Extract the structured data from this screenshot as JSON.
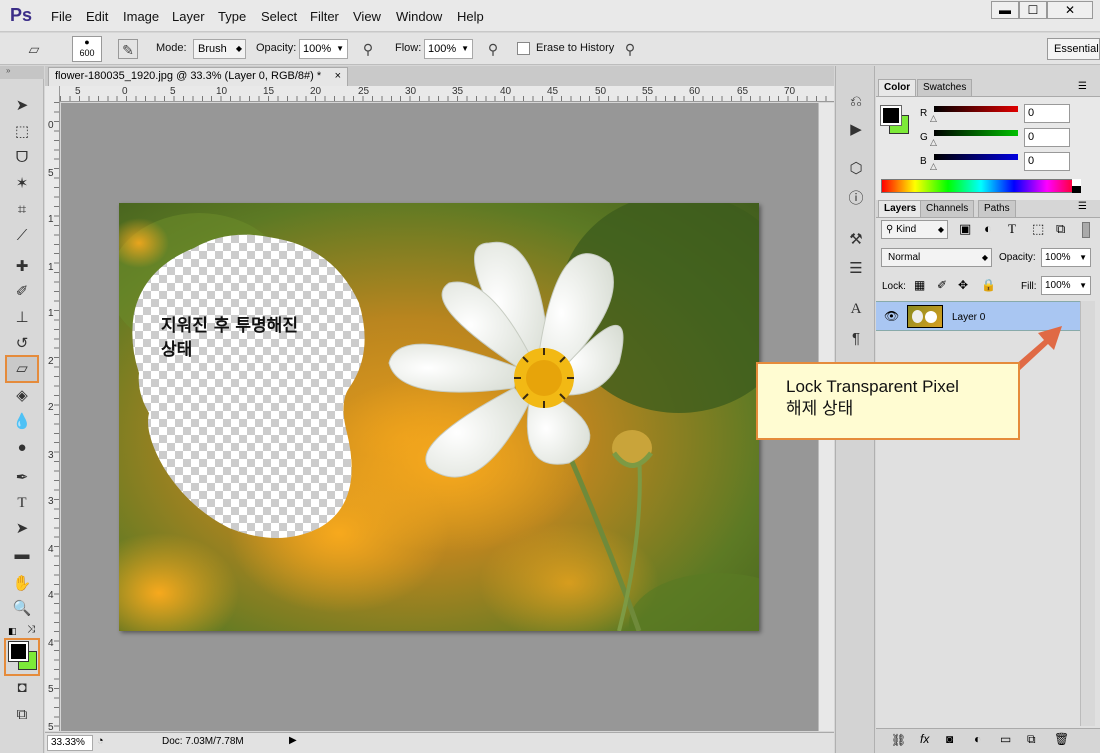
{
  "app": {
    "logo": "Ps"
  },
  "menu": [
    "File",
    "Edit",
    "Image",
    "Layer",
    "Type",
    "Select",
    "Filter",
    "View",
    "Window",
    "Help"
  ],
  "window_controls": {
    "minimize": "▬",
    "maximize": "☐",
    "close": "✕"
  },
  "options": {
    "brush_size": "600",
    "mode_label": "Mode:",
    "mode_value": "Brush",
    "opacity_label": "Opacity:",
    "opacity_value": "100%",
    "flow_label": "Flow:",
    "flow_value": "100%",
    "erase_history_label": "Erase to History",
    "workspace": "Essential"
  },
  "document": {
    "tab_title": "flower-180035_1920.jpg @ 33.3% (Layer 0, RGB/8#) *",
    "tab_close": "×",
    "ruler_h": [
      "5",
      "0",
      "5",
      "10",
      "15",
      "20",
      "25",
      "30",
      "35",
      "40",
      "45",
      "50",
      "55",
      "60",
      "65",
      "70"
    ],
    "ruler_v": [
      "0",
      "5",
      "1",
      "1",
      "1",
      "2",
      "2",
      "3",
      "3",
      "4",
      "4",
      "4",
      "5",
      "5"
    ],
    "annotation_text_line1": "지워진 후 투명해진",
    "annotation_text_line2": "상태"
  },
  "status": {
    "zoom": "33.33%",
    "doc": "Doc: 7.03M/7.78M"
  },
  "color_panel": {
    "tabs": [
      "Color",
      "Swatches"
    ],
    "channels": [
      {
        "label": "R",
        "value": "0",
        "color": "#d00000"
      },
      {
        "label": "G",
        "value": "0",
        "color": "#00a000"
      },
      {
        "label": "B",
        "value": "0",
        "color": "#0000d0"
      }
    ],
    "foreground": "#000000",
    "background": "#7dea38"
  },
  "layers_panel": {
    "tabs": [
      "Layers",
      "Channels",
      "Paths"
    ],
    "filter_kind": "Kind",
    "blend_mode": "Normal",
    "opacity_label": "Opacity:",
    "opacity_value": "100%",
    "lock_label": "Lock:",
    "fill_label": "Fill:",
    "fill_value": "100%",
    "layer_name": "Layer 0"
  },
  "callout": {
    "line1": "Lock Transparent Pixel",
    "line2": "해제 상태",
    "border_color": "#e58b3b"
  }
}
